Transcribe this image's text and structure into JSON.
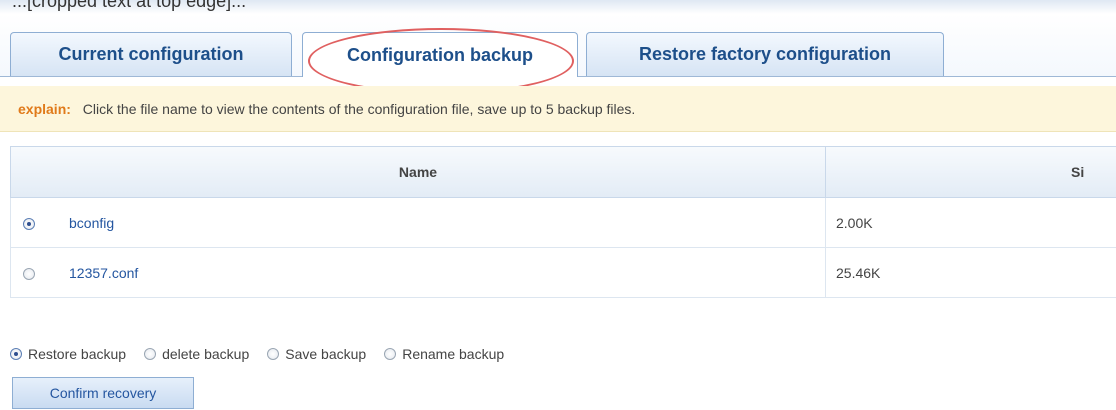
{
  "top_text": "...[cropped text at top edge]...",
  "tabs": [
    {
      "label": "Current configuration",
      "active": false
    },
    {
      "label": "Configuration backup",
      "active": true
    },
    {
      "label": "Restore factory configuration",
      "active": false
    }
  ],
  "explain": {
    "label": "explain:",
    "text": "Click the file name to view the contents of the configuration file, save up to 5 backup files."
  },
  "table": {
    "columns": [
      "Name",
      "Si"
    ],
    "rows": [
      {
        "name": "bconfig",
        "size": "2.00K",
        "selected": true
      },
      {
        "name": "12357.conf",
        "size": "25.46K",
        "selected": false
      }
    ]
  },
  "actions": {
    "options": [
      {
        "label": "Restore backup",
        "checked": true
      },
      {
        "label": "delete backup",
        "checked": false
      },
      {
        "label": "Save backup",
        "checked": false
      },
      {
        "label": "Rename backup",
        "checked": false
      }
    ],
    "confirm_label": "Confirm recovery"
  },
  "colors": {
    "tab_text": "#1d4f8a",
    "explain_label": "#e07a1a",
    "explain_bg": "#fdf6dc",
    "link": "#2456a0",
    "highlight_circle": "#e06060"
  }
}
